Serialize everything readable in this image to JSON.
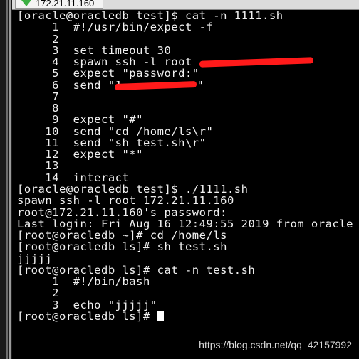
{
  "tab": {
    "label": "172.21.11.160",
    "icon": "connected-check-icon"
  },
  "terminal": {
    "lines": [
      "[oracle@oracledb test]$ cat -n 1111.sh",
      "     1  #!/usr/bin/expect -f",
      "     2",
      "     3  set timeout 30",
      "     4  spawn ssh -l root ",
      "     5  expect \"password:\"",
      "     6  send \"1",
      "     7",
      "     8",
      "     9  expect \"#\"",
      "    10  send \"cd /home/ls\\r\"",
      "    11  send \"sh test.sh\\r\"",
      "    12  expect \"*\"",
      "    13",
      "    14  interact",
      "[oracle@oracledb test]$ ./1111.sh",
      "spawn ssh -l root 172.21.11.160",
      "root@172.21.11.160's password:",
      "Last login: Fri Aug 16 12:49:55 2019 from oracle",
      "[root@oracledb ~]# cd /home/ls",
      "[root@oracledb ls]# sh test.sh",
      "jjjjj",
      "[root@oracledb ls]# cat -n test.sh",
      "     1  #!/bin/bash",
      "     2",
      "     3  echo \"jjjjj\"",
      "[root@oracledb ls]# "
    ],
    "line6_suffix": "\"",
    "redaction_color": "#ff1a1a"
  },
  "watermark": "https://blog.csdn.net/qq_42157992"
}
